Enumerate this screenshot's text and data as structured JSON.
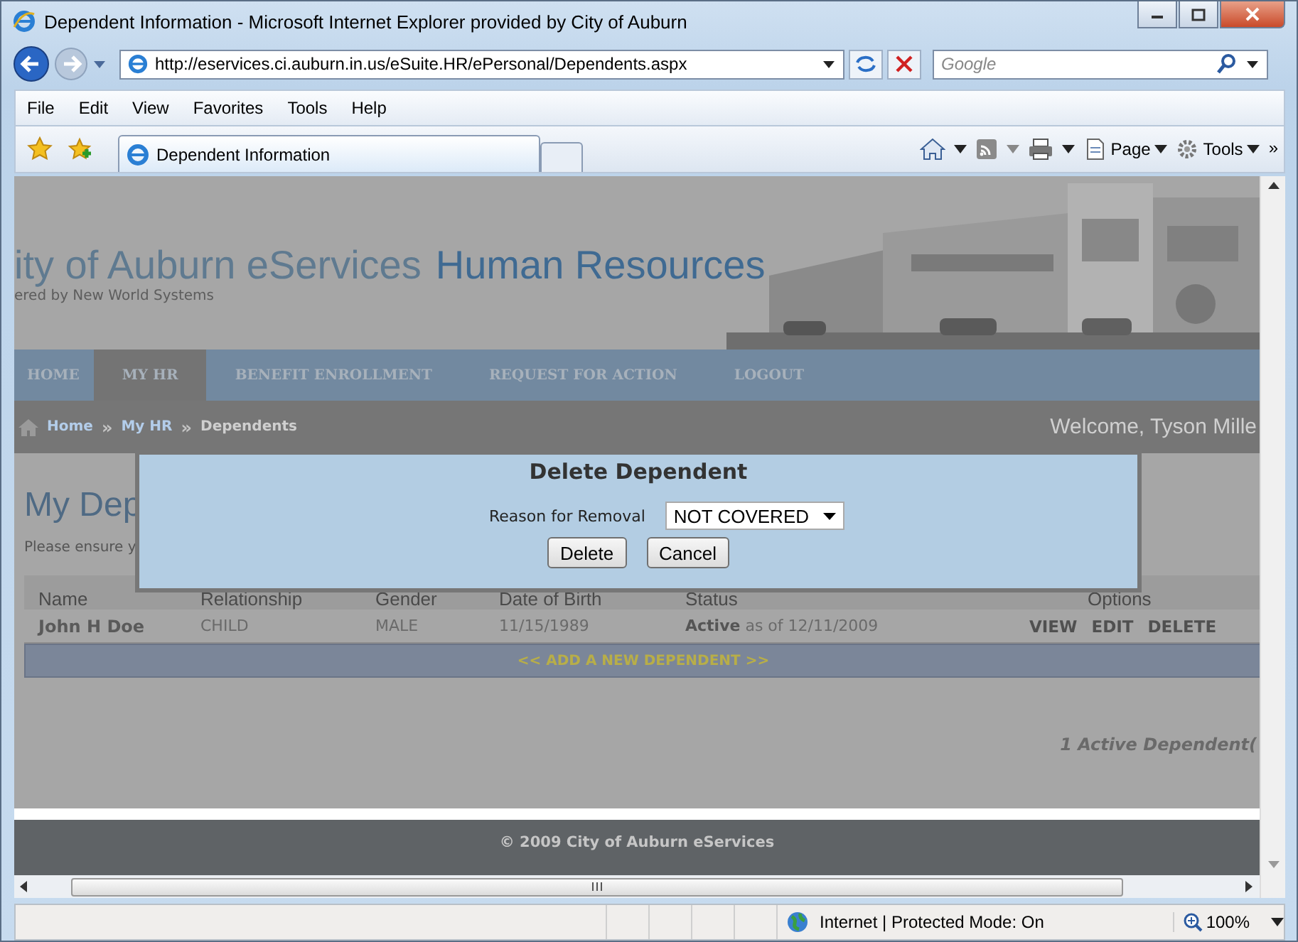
{
  "window": {
    "title": "Dependent Information - Microsoft Internet Explorer provided by City of Auburn"
  },
  "address_bar": {
    "url": "http://eservices.ci.auburn.in.us/eSuite.HR/ePersonal/Dependents.aspx"
  },
  "search": {
    "placeholder": "Google"
  },
  "menu": [
    "File",
    "Edit",
    "View",
    "Favorites",
    "Tools",
    "Help"
  ],
  "tabs": [
    {
      "label": "Dependent Information",
      "selected": true
    }
  ],
  "command_bar": {
    "items": [
      "Page",
      "Tools"
    ],
    "overflow": "»"
  },
  "page": {
    "header": {
      "title": "ity of Auburn eServices",
      "subtitle": "Human Resources",
      "tagline": "ered by New World Systems"
    },
    "nav": [
      {
        "label": "HOME",
        "selected": false
      },
      {
        "label": "MY HR",
        "selected": true
      },
      {
        "label": "BENEFIT ENROLLMENT",
        "selected": false
      },
      {
        "label": "REQUEST FOR ACTION",
        "selected": false
      },
      {
        "label": "LOGOUT",
        "selected": false
      }
    ],
    "breadcrumb": {
      "items": [
        "Home",
        "My HR",
        "Dependents"
      ],
      "separator": "»"
    },
    "welcome": "Welcome, Tyson Mille",
    "heading": "My Dep",
    "intro": "Please ensure y",
    "table": {
      "columns": [
        "Name",
        "Relationship",
        "Gender",
        "Date of Birth",
        "Status",
        "Options"
      ],
      "rows": [
        {
          "cells": [
            "John H Doe",
            "CHILD",
            "MALE",
            "11/15/1989",
            "**Active** as of 12/11/2009"
          ],
          "actions": [
            "VIEW",
            "EDIT",
            "DELETE"
          ]
        }
      ]
    },
    "add_link": "<< ADD A NEW DEPENDENT >>",
    "summary": "1 Active Dependent(",
    "footer": "© 2009 City of Auburn eServices"
  },
  "dialog": {
    "title": "Delete Dependent",
    "label": "Reason for Removal",
    "value": "NOT COVERED",
    "buttons": [
      "Delete",
      "Cancel"
    ]
  },
  "status_bar": {
    "zone": "Internet | Protected Mode: On",
    "zoom": "100%"
  }
}
